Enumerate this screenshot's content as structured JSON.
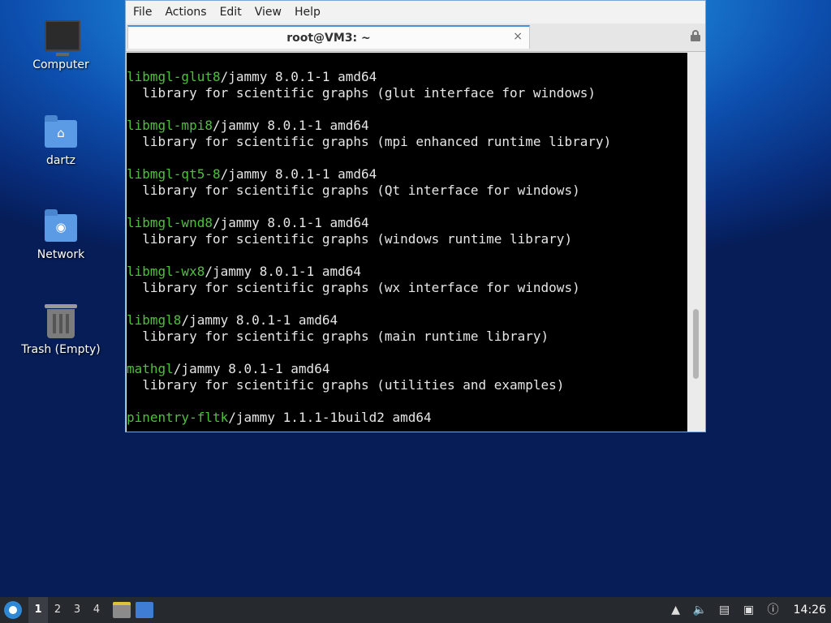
{
  "desktop": {
    "icons": [
      {
        "label": "Computer",
        "icon": "computer-icon"
      },
      {
        "label": "dartz",
        "icon": "home-folder-icon"
      },
      {
        "label": "Network",
        "icon": "network-folder-icon"
      },
      {
        "label": "Trash (Empty)",
        "icon": "trash-icon"
      }
    ]
  },
  "window": {
    "menu": [
      "File",
      "Actions",
      "Edit",
      "View",
      "Help"
    ],
    "tab_title": "root@VM3: ~",
    "tab_close_glyph": "×",
    "lock_icon": "lock-icon"
  },
  "terminal": {
    "lines": [
      {
        "pkg": "",
        "text": ""
      },
      {
        "pkg": "libmgl-glut8",
        "text": "/jammy 8.0.1-1 amd64"
      },
      {
        "pkg": "",
        "text": "  library for scientific graphs (glut interface for windows)"
      },
      {
        "pkg": "",
        "text": ""
      },
      {
        "pkg": "libmgl-mpi8",
        "text": "/jammy 8.0.1-1 amd64"
      },
      {
        "pkg": "",
        "text": "  library for scientific graphs (mpi enhanced runtime library)"
      },
      {
        "pkg": "",
        "text": ""
      },
      {
        "pkg": "libmgl-qt5-8",
        "text": "/jammy 8.0.1-1 amd64"
      },
      {
        "pkg": "",
        "text": "  library for scientific graphs (Qt interface for windows)"
      },
      {
        "pkg": "",
        "text": ""
      },
      {
        "pkg": "libmgl-wnd8",
        "text": "/jammy 8.0.1-1 amd64"
      },
      {
        "pkg": "",
        "text": "  library for scientific graphs (windows runtime library)"
      },
      {
        "pkg": "",
        "text": ""
      },
      {
        "pkg": "libmgl-wx8",
        "text": "/jammy 8.0.1-1 amd64"
      },
      {
        "pkg": "",
        "text": "  library for scientific graphs (wx interface for windows)"
      },
      {
        "pkg": "",
        "text": ""
      },
      {
        "pkg": "libmgl8",
        "text": "/jammy 8.0.1-1 amd64"
      },
      {
        "pkg": "",
        "text": "  library for scientific graphs (main runtime library)"
      },
      {
        "pkg": "",
        "text": ""
      },
      {
        "pkg": "mathgl",
        "text": "/jammy 8.0.1-1 amd64"
      },
      {
        "pkg": "",
        "text": "  library for scientific graphs (utilities and examples)"
      },
      {
        "pkg": "",
        "text": ""
      },
      {
        "pkg": "pinentry-fltk",
        "text": "/jammy 1.1.1-1build2 amd64"
      }
    ],
    "colors": {
      "package": "#4ec13b",
      "text": "#e6e6e6",
      "background": "#000000"
    }
  },
  "taskbar": {
    "workspaces": [
      "1",
      "2",
      "3",
      "4"
    ],
    "active_workspace": "1",
    "apps": [
      {
        "name": "file-manager-icon"
      },
      {
        "name": "terminal-icon"
      }
    ],
    "tray": [
      "clipboard-icon",
      "volume-icon",
      "notes-icon",
      "network-icon",
      "updates-icon"
    ],
    "clock": "14:26"
  }
}
